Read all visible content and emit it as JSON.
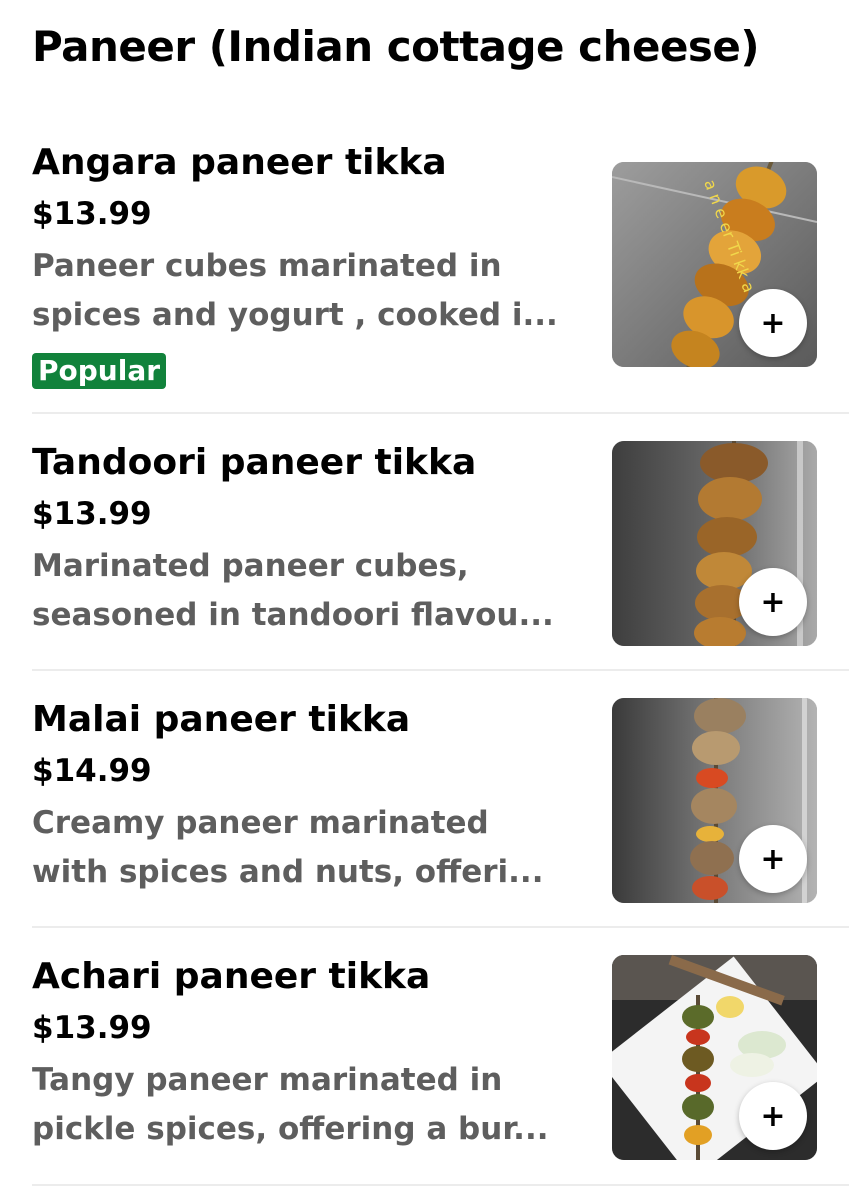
{
  "section": {
    "title": "Paneer (Indian cottage cheese)"
  },
  "items": [
    {
      "name": "Angara paneer tikka",
      "price": "$13.99",
      "desc_line1": "Paneer cubes marinated in",
      "desc_line2": "spices and yogurt , cooked i...",
      "badge": "Popular",
      "photo_caption": "a n e er Ti kk a",
      "add_label": "+"
    },
    {
      "name": "Tandoori paneer tikka",
      "price": "$13.99",
      "desc_line1": "Marinated paneer cubes,",
      "desc_line2": "seasoned in tandoori  flavou...",
      "add_label": "+"
    },
    {
      "name": "Malai paneer tikka",
      "price": "$14.99",
      "desc_line1": "Creamy paneer marinated",
      "desc_line2": "with spices and nuts, offeri...",
      "add_label": "+"
    },
    {
      "name": "Achari paneer tikka",
      "price": "$13.99",
      "desc_line1": "Tangy paneer marinated in",
      "desc_line2": "pickle spices, offering a bur...",
      "add_label": "+"
    }
  ],
  "colors": {
    "badge": "#11823b",
    "description": "#5e5e5e",
    "divider": "#ececec"
  }
}
